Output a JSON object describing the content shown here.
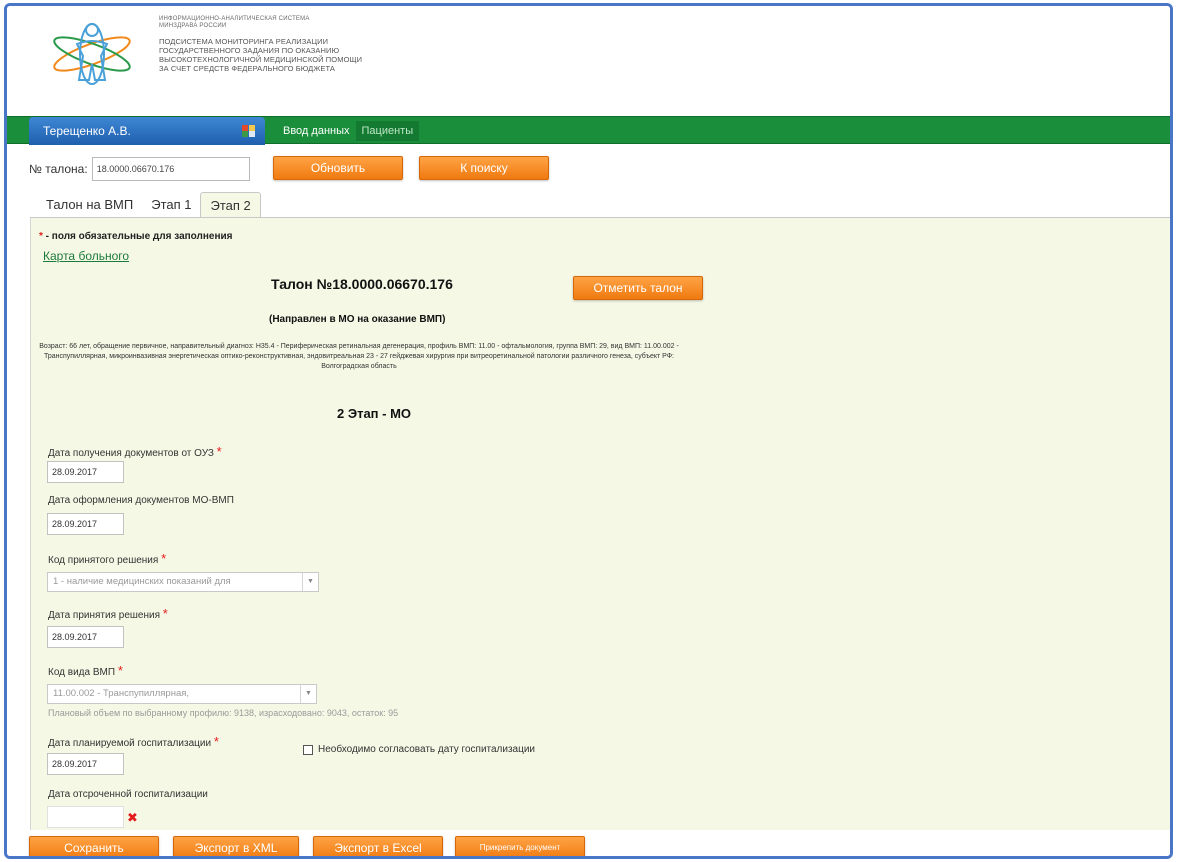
{
  "header": {
    "small_lines": [
      "ИНФОРМАЦИОННО-АНАЛИТИЧЕСКАЯ СИСТЕМА",
      "МИНЗДРАВА РОССИИ"
    ],
    "main_lines": [
      "ПОДСИСТЕМА МОНИТОРИНГА РЕАЛИЗАЦИИ",
      "ГОСУДАРСТВЕННОГО ЗАДАНИЯ ПО ОКАЗАНИЮ",
      "ВЫСОКОТЕХНОЛОГИЧНОЙ МЕДИЦИНСКОЙ ПОМОЩИ",
      "ЗА СЧЕТ СРЕДСТВ ФЕДЕРАЛЬНОГО БЮДЖЕТА"
    ]
  },
  "navbar": {
    "user_name": "Терещенко А.В.",
    "items": [
      {
        "label": "Ввод данных"
      },
      {
        "label": "Пациенты"
      }
    ]
  },
  "search": {
    "label": "№ талона:",
    "value": "18.0000.06670.176",
    "refresh_label": "Обновить",
    "to_search_label": "К поиску"
  },
  "tabs": [
    {
      "label": "Талон на ВМП"
    },
    {
      "label": "Этап 1"
    },
    {
      "label": "Этап 2"
    }
  ],
  "content": {
    "required_star": "*",
    "required_note": " - поля обязательные для заполнения",
    "card_link": "Карта больного",
    "title": "Талон №18.0000.06670.176",
    "mark_button": "Отметить талон",
    "subtitle": "(Направлен в МО на оказание ВМП)",
    "description": "Возраст: 66 лет, обращение первичное, направительный диагноз: H35.4 - Периферическая ретинальная дегенерация, профиль ВМП: 11.00 - офтальмология, группа ВМП: 29, вид ВМП: 11.00.002 - Транспупиллярная, микроинвазивная энергетическая оптико-реконструктивная, эндовитреальная 23 - 27 гейджевая хирургия при витреоретинальной патологии различного генеза, субъект РФ: Волгоградская область",
    "stage_title": "2 Этап - МО"
  },
  "fields": {
    "docs_received_label": "Дата получения документов от ОУЗ",
    "docs_received_value": "28.09.2017",
    "docs_issued_label": "Дата оформления документов МО-ВМП",
    "docs_issued_value": "28.09.2017",
    "decision_code_label": "Код принятого решения",
    "decision_code_value": "1 - наличие медицинских показаний для",
    "decision_date_label": "Дата принятия решения",
    "decision_date_value": "28.09.2017",
    "vmp_code_label": "Код вида ВМП",
    "vmp_code_value": "11.00.002 - Транспупиллярная,",
    "plan_hint": "Плановый объем по выбранному профилю: 9138, израсходовано: 9043, остаток: 95",
    "planned_hosp_label": "Дата планируемой госпитализации",
    "planned_hosp_value": "28.09.2017",
    "agree_date_label": "Необходимо согласовать дату госпитализации",
    "postponed_hosp_label": "Дата отсроченной госпитализации",
    "postponed_hosp_value": "",
    "clear_symbol": "✖"
  },
  "footer": {
    "save": "Сохранить",
    "export_xml": "Экспорт в XML",
    "export_excel": "Экспорт в Excel",
    "attach": "Прикрепить документ"
  },
  "colors": {
    "accent_orange": "#f07a10",
    "nav_green": "#1a8e3a",
    "user_blue": "#1f5fae",
    "content_bg": "#f6f8e6",
    "required_red": "#e31b1b"
  }
}
